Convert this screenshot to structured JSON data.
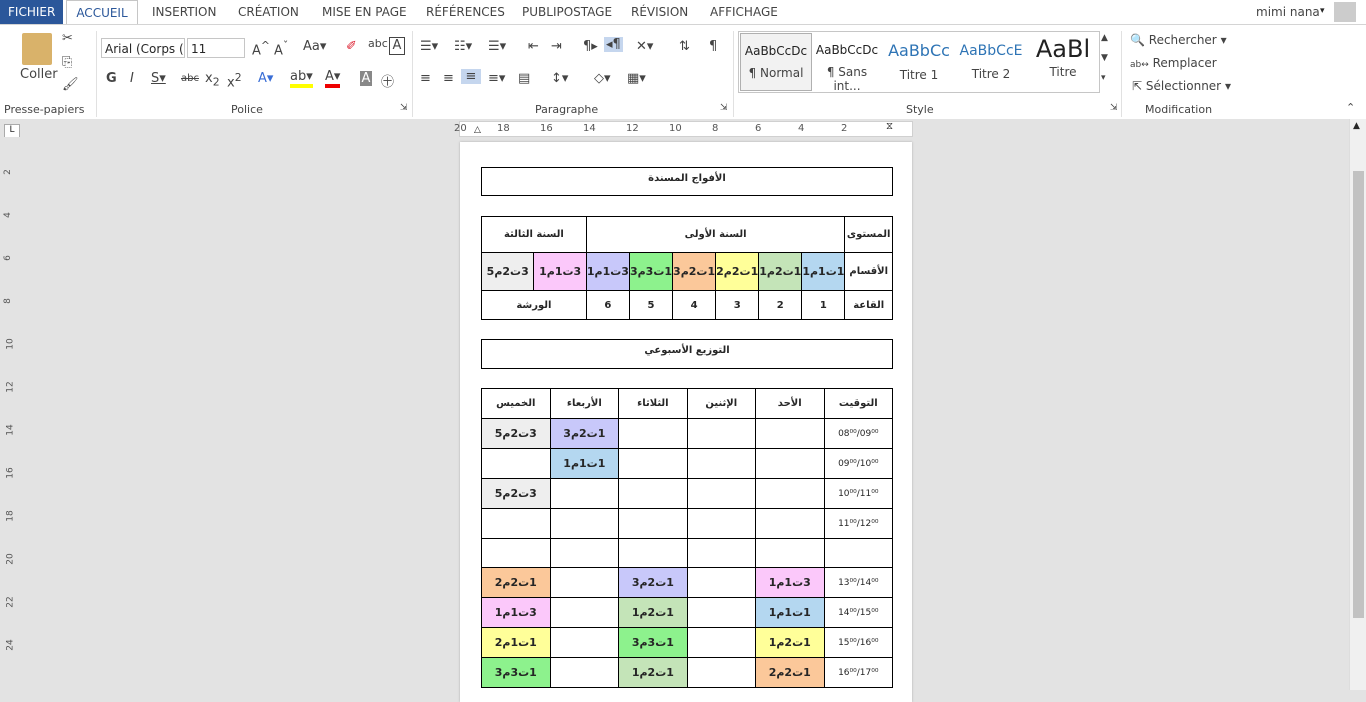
{
  "tabs": [
    "FICHIER",
    "ACCUEIL",
    "INSERTION",
    "CRÉATION",
    "MISE EN PAGE",
    "RÉFÉRENCES",
    "PUBLIPOSTAGE",
    "RÉVISION",
    "AFFICHAGE"
  ],
  "user": "mimi nana",
  "clipboard": {
    "paste": "Coller",
    "label": "Presse-papiers"
  },
  "font": {
    "name": "Arial (Corps (",
    "size": "11",
    "label": "Police"
  },
  "paragraph": {
    "label": "Paragraphe"
  },
  "styles": {
    "label": "Style",
    "items": [
      {
        "sample": "AaBbCcDc",
        "name": "¶ Normal"
      },
      {
        "sample": "AaBbCcDc",
        "name": "¶ Sans int..."
      },
      {
        "sample": "AaBbCc",
        "name": "Titre 1"
      },
      {
        "sample": "AaBbCcE",
        "name": "Titre 2"
      },
      {
        "sample": "AaBl",
        "name": "Titre"
      }
    ]
  },
  "editing": {
    "label": "Modification",
    "find": "Rechercher",
    "replace": "Remplacer",
    "select": "Sélectionner"
  },
  "colors": {
    "file_tab": "#2b579a",
    "blue": "#b4d7f0",
    "green": "#c4e4b8",
    "yellow": "#ffff99",
    "orange": "#fbc89a",
    "brightgreen": "#8df28d",
    "lavender": "#c8c8fa",
    "pink": "#fbc8fa",
    "grey": "#eeeeee"
  },
  "hruler": [
    "20",
    "18",
    "16",
    "14",
    "12",
    "10",
    "8",
    "6",
    "4",
    "2"
  ],
  "vruler": [
    "2",
    "4",
    "6",
    "8",
    "10",
    "12",
    "14",
    "16",
    "18",
    "20",
    "22",
    "24"
  ],
  "doc": {
    "title1": "الأفواج المسندة",
    "levels": {
      "head": "المستوى",
      "year1": "السنة الأولى",
      "year3": "السنة الثالثة",
      "sections": "الأقسام",
      "room": "القاعة",
      "workshop": "الورشة",
      "classes": [
        "1ت1م1",
        "1ت2م1",
        "1ت2م2",
        "1ت2م3",
        "1ت3م3",
        "3ت1م1",
        "3ت2م5"
      ],
      "rooms": [
        "1",
        "2",
        "3",
        "4",
        "5",
        "6"
      ]
    },
    "title2": "التوزيع الأسبوعي",
    "week": {
      "head": "التوقيت",
      "days": [
        "الأحد",
        "الإثنين",
        "الثلاثاء",
        "الأربعاء",
        "الخميس"
      ],
      "times": [
        "08⁰⁰/09⁰⁰",
        "09⁰⁰/10⁰⁰",
        "10⁰⁰/11⁰⁰",
        "11⁰⁰/12⁰⁰",
        "",
        "13⁰⁰/14⁰⁰",
        "14⁰⁰/15⁰⁰",
        "15⁰⁰/16⁰⁰",
        "16⁰⁰/17⁰⁰"
      ],
      "cells": {
        "r0_wed": "1ت2م3",
        "r0_thu": "3ت2م5",
        "r1_wed": "1ت1م1",
        "r2_thu": "3ت2م5",
        "r5_sun": "3ت1م1",
        "r5_tue": "1ت2م3",
        "r5_thu": "1ت2م2",
        "r6_sun": "1ت1م1",
        "r6_tue": "1ت2م1",
        "r6_thu": "3ت1م1",
        "r7_sun": "1ت2م1",
        "r7_tue": "1ت3م3",
        "r7_thu": "1ت1م2",
        "r8_sun": "1ت2م2",
        "r8_tue": "1ت2م1",
        "r8_thu": "1ت3م3"
      }
    }
  }
}
